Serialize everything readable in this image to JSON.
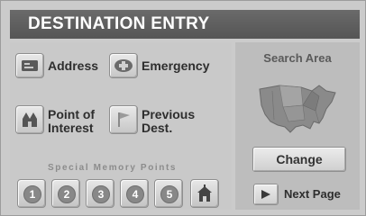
{
  "header": {
    "title": "DESTINATION ENTRY"
  },
  "menu": {
    "address": {
      "label": "Address",
      "icon": "address-card-icon"
    },
    "emergency": {
      "label": "Emergency",
      "icon": "emergency-icon"
    },
    "poi": {
      "label_line1": "Point of",
      "label_line2": "Interest",
      "icon": "point-of-interest-icon"
    },
    "previous": {
      "label_line1": "Previous",
      "label_line2": "Dest.",
      "icon": "flag-icon"
    }
  },
  "memory": {
    "caption": "Special Memory Points",
    "buttons": [
      "1",
      "2",
      "3",
      "4",
      "5"
    ],
    "home_icon": "home-icon"
  },
  "search": {
    "label": "Search Area",
    "map_icon": "usa-map-icon",
    "change_label": "Change"
  },
  "next": {
    "label": "Next Page",
    "icon": "right-arrow-icon"
  },
  "colors": {
    "title_bar": "#5f5f5f",
    "background": "#cbcbcb",
    "right_panel": "#bdbdbd",
    "memory_circle": "#888888"
  }
}
